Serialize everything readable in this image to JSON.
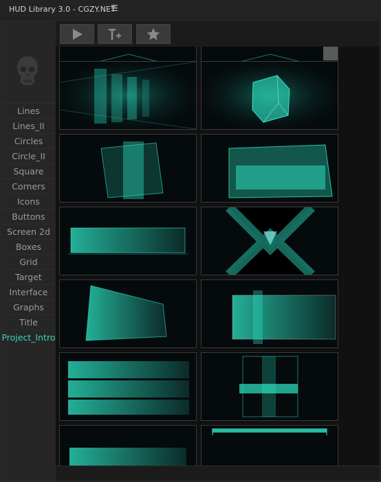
{
  "window": {
    "title": "HUD Library 3.0 - CGZY.NET",
    "menu_icon": "hamburger-icon"
  },
  "toolbar": {
    "buttons": [
      {
        "name": "play-button",
        "icon": "play-icon"
      },
      {
        "name": "add-text-button",
        "icon": "text-add-icon"
      },
      {
        "name": "favorite-button",
        "icon": "star-icon"
      }
    ]
  },
  "sidebar": {
    "logo_icon": "skull-icon",
    "items": [
      {
        "label": "Lines"
      },
      {
        "label": "Lines_II"
      },
      {
        "label": "Circles"
      },
      {
        "label": "Circle_II"
      },
      {
        "label": "Square"
      },
      {
        "label": "Corners"
      },
      {
        "label": "Icons"
      },
      {
        "label": "Buttons"
      },
      {
        "label": "Screen 2d"
      },
      {
        "label": "Boxes"
      },
      {
        "label": "Grid"
      },
      {
        "label": "Target"
      },
      {
        "label": "Interface"
      },
      {
        "label": "Graphs"
      },
      {
        "label": "Title"
      },
      {
        "label": "Project_Intro",
        "active": true
      }
    ]
  },
  "thumbnails": [
    {
      "name": "hud-preview-1",
      "kind": "partial"
    },
    {
      "name": "hud-preview-2",
      "kind": "partial"
    },
    {
      "name": "hud-preview-3",
      "kind": "panels-perspective"
    },
    {
      "name": "hud-preview-4",
      "kind": "glowing-cube"
    },
    {
      "name": "hud-preview-5",
      "kind": "box-tilted"
    },
    {
      "name": "hud-preview-6",
      "kind": "platform-3d"
    },
    {
      "name": "hud-preview-7",
      "kind": "bar-wide"
    },
    {
      "name": "hud-preview-8",
      "kind": "x-cross"
    },
    {
      "name": "hud-preview-9",
      "kind": "skewed-panel"
    },
    {
      "name": "hud-preview-10",
      "kind": "framed-panel"
    },
    {
      "name": "hud-preview-11",
      "kind": "stacked-bars"
    },
    {
      "name": "hud-preview-12",
      "kind": "stacked-cross"
    },
    {
      "name": "hud-preview-13",
      "kind": "bottom-panel"
    },
    {
      "name": "hud-preview-14",
      "kind": "top-bar"
    }
  ],
  "colors": {
    "accent": "#3fd3b7",
    "glow": "#2ee6c6",
    "panel_bg": "#232323"
  }
}
